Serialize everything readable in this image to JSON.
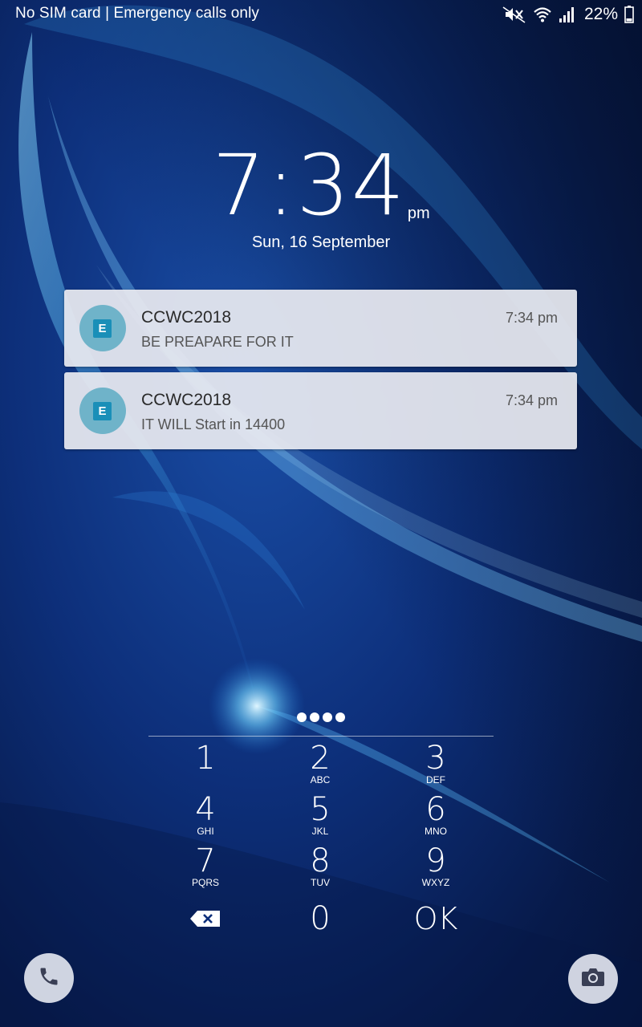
{
  "status_bar": {
    "carrier": "No SIM card | Emergency calls only",
    "battery_percent": "22%",
    "icons": [
      "mute-icon",
      "wifi-icon",
      "signal-icon",
      "battery-icon"
    ],
    "battery_level": 0.22
  },
  "lockscreen": {
    "time": "7:34",
    "ampm": "pm",
    "date": "Sun, 16 September"
  },
  "notifications": [
    {
      "app_initial": "E",
      "title": "CCWC2018",
      "text": "BE PREAPARE FOR IT",
      "time": "7:34 pm"
    },
    {
      "app_initial": "E",
      "title": "CCWC2018",
      "text": "IT WILL Start in 14400",
      "time": "7:34 pm"
    }
  ],
  "pin_entry": {
    "entered_digits": 4
  },
  "keypad": {
    "keys": [
      {
        "digit": "1",
        "letters": ""
      },
      {
        "digit": "2",
        "letters": "ABC"
      },
      {
        "digit": "3",
        "letters": "DEF"
      },
      {
        "digit": "4",
        "letters": "GHI"
      },
      {
        "digit": "5",
        "letters": "JKL"
      },
      {
        "digit": "6",
        "letters": "MNO"
      },
      {
        "digit": "7",
        "letters": "PQRS"
      },
      {
        "digit": "8",
        "letters": "TUV"
      },
      {
        "digit": "9",
        "letters": "WXYZ"
      },
      {
        "digit": "0",
        "letters": ""
      }
    ],
    "ok_label": "OK",
    "backspace_icon": "backspace-icon"
  },
  "shortcuts": {
    "left_icon": "phone-icon",
    "right_icon": "camera-icon"
  },
  "colors": {
    "accent_background": "#0d2f7a",
    "notification_icon_bg": "#6fb3c9",
    "notification_icon_fg": "#1a8fb8"
  }
}
